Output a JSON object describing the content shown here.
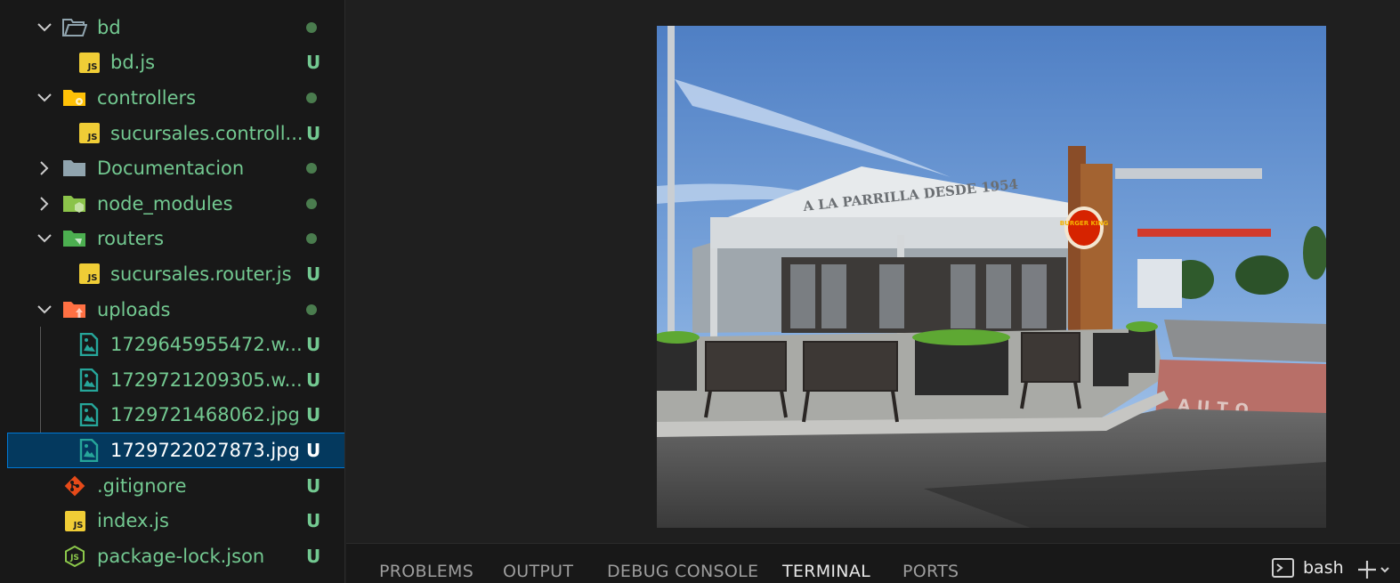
{
  "explorer": {
    "items": [
      {
        "label": "bd",
        "kind": "folder",
        "icon": "folder-open-icon",
        "expanded": true,
        "status": "dot"
      },
      {
        "label": "bd.js",
        "kind": "js",
        "icon": "js-file-icon",
        "status": "U"
      },
      {
        "label": "controllers",
        "kind": "folder",
        "icon": "folder-controllers-icon",
        "expanded": true,
        "status": "dot"
      },
      {
        "label": "sucursales.controll...",
        "kind": "js",
        "icon": "js-file-icon",
        "status": "U"
      },
      {
        "label": "Documentacion",
        "kind": "folder",
        "icon": "folder-icon",
        "expanded": false,
        "status": "dot"
      },
      {
        "label": "node_modules",
        "kind": "folder",
        "icon": "folder-node-icon",
        "expanded": false,
        "status": "dot"
      },
      {
        "label": "routers",
        "kind": "folder",
        "icon": "folder-routes-icon",
        "expanded": true,
        "status": "dot"
      },
      {
        "label": "sucursales.router.js",
        "kind": "js",
        "icon": "js-file-icon",
        "status": "U"
      },
      {
        "label": "uploads",
        "kind": "folder",
        "icon": "folder-upload-icon",
        "expanded": true,
        "status": "dot"
      },
      {
        "label": "1729645955472.w...",
        "kind": "image",
        "icon": "image-file-icon",
        "status": "U"
      },
      {
        "label": "1729721209305.w...",
        "kind": "image",
        "icon": "image-file-icon",
        "status": "U"
      },
      {
        "label": "1729721468062.jpg",
        "kind": "image",
        "icon": "image-file-icon",
        "status": "U"
      },
      {
        "label": "1729722027873.jpg",
        "kind": "image",
        "icon": "image-file-icon",
        "status": "U",
        "selected": true
      },
      {
        "label": ".gitignore",
        "kind": "git",
        "icon": "git-icon",
        "status": "U"
      },
      {
        "label": "index.js",
        "kind": "js",
        "icon": "js-file-icon",
        "status": "U"
      },
      {
        "label": "package-lock.json",
        "kind": "nodejs",
        "icon": "nodejs-icon",
        "status": "U"
      }
    ]
  },
  "editor": {
    "image": {
      "restaurant_sign": "A LA PARRILLA DESDE 1954",
      "logo_text": "BURGER KING",
      "road_marking": "AUTO"
    }
  },
  "panel": {
    "tabs": [
      "PROBLEMS",
      "OUTPUT",
      "DEBUG CONSOLE",
      "TERMINAL",
      "PORTS"
    ],
    "active_tab": "TERMINAL",
    "terminal_label": "bash"
  },
  "colors": {
    "git_untracked": "#73c991",
    "selection_bg": "#04395e",
    "focus_border": "#0078d4",
    "js_icon": "#f0cd36"
  }
}
